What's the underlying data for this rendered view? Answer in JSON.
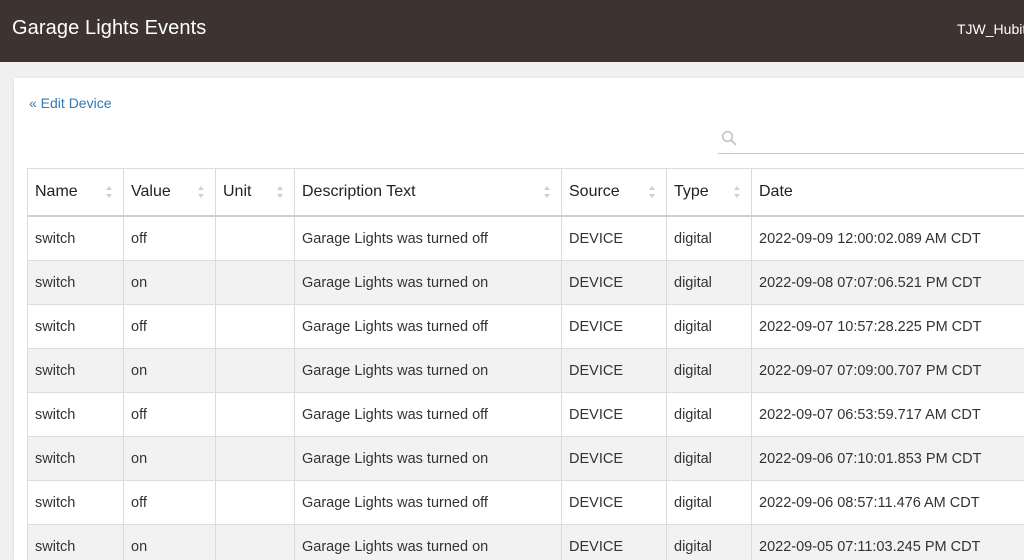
{
  "header": {
    "title": "Garage Lights Events",
    "hub_name": "TJW_Hubitat"
  },
  "back_link": "« Edit Device",
  "search": {
    "value": "",
    "placeholder": ""
  },
  "table": {
    "columns": [
      "Name",
      "Value",
      "Unit",
      "Description Text",
      "Source",
      "Type",
      "Date"
    ],
    "rows": [
      [
        "switch",
        "off",
        "",
        "Garage Lights was turned off",
        "DEVICE",
        "digital",
        "2022-09-09 12:00:02.089 AM CDT"
      ],
      [
        "switch",
        "on",
        "",
        "Garage Lights was turned on",
        "DEVICE",
        "digital",
        "2022-09-08 07:07:06.521 PM CDT"
      ],
      [
        "switch",
        "off",
        "",
        "Garage Lights was turned off",
        "DEVICE",
        "digital",
        "2022-09-07 10:57:28.225 PM CDT"
      ],
      [
        "switch",
        "on",
        "",
        "Garage Lights was turned on",
        "DEVICE",
        "digital",
        "2022-09-07 07:09:00.707 PM CDT"
      ],
      [
        "switch",
        "off",
        "",
        "Garage Lights was turned off",
        "DEVICE",
        "digital",
        "2022-09-07 06:53:59.717 AM CDT"
      ],
      [
        "switch",
        "on",
        "",
        "Garage Lights was turned on",
        "DEVICE",
        "digital",
        "2022-09-06 07:10:01.853 PM CDT"
      ],
      [
        "switch",
        "off",
        "",
        "Garage Lights was turned off",
        "DEVICE",
        "digital",
        "2022-09-06 08:57:11.476 AM CDT"
      ],
      [
        "switch",
        "on",
        "",
        "Garage Lights was turned on",
        "DEVICE",
        "digital",
        "2022-09-05 07:11:03.245 PM CDT"
      ]
    ]
  },
  "colors": {
    "topbar": "#3d3330",
    "link": "#2f79b4",
    "stripe": "#f2f2f2"
  },
  "icons": {
    "search": "search-icon",
    "sort": "sort-icon"
  }
}
